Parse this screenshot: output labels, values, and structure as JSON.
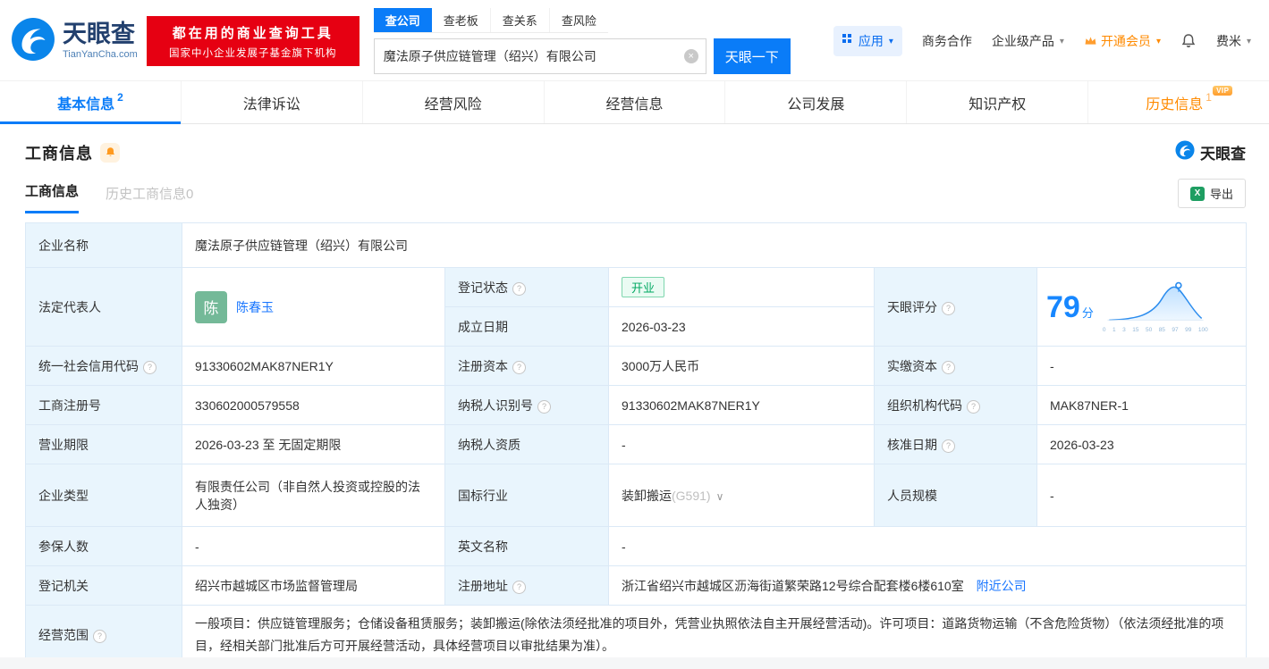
{
  "brand": {
    "name": "天眼查",
    "domain": "TianYanCha.com",
    "slogan1": "都在用的商业查询工具",
    "slogan2": "国家中小企业发展子基金旗下机构"
  },
  "search": {
    "tabs": [
      "查公司",
      "查老板",
      "查关系",
      "查风险"
    ],
    "value": "魔法原子供应链管理（绍兴）有限公司",
    "button": "天眼一下"
  },
  "topnav": {
    "app": "应用",
    "cooperation": "商务合作",
    "enterprise": "企业级产品",
    "vip": "开通会员",
    "user": "费米"
  },
  "icons": {
    "help": "?",
    "clear": "×",
    "caret": "▾",
    "chevron": "∨",
    "excel": "X"
  },
  "tabs": {
    "basic": "基本信息",
    "basic_count": "2",
    "legal": "法律诉讼",
    "risk": "经营风险",
    "operation": "经营信息",
    "development": "公司发展",
    "ip": "知识产权",
    "history": "历史信息",
    "history_count": "1",
    "vip_tag": "VIP"
  },
  "section": {
    "title": "工商信息",
    "subtab_current": "工商信息",
    "subtab_history": "历史工商信息0",
    "export": "导出",
    "brand": "天眼查"
  },
  "fields": {
    "company_name": {
      "label": "企业名称",
      "value": "魔法原子供应链管理（绍兴）有限公司"
    },
    "legal_rep": {
      "label": "法定代表人",
      "avatar": "陈",
      "name": "陈春玉"
    },
    "reg_status": {
      "label": "登记状态",
      "value": "开业"
    },
    "establish_date": {
      "label": "成立日期",
      "value": "2026-03-23"
    },
    "score": {
      "label": "天眼评分",
      "value": "79",
      "unit": "分",
      "axis": [
        "0",
        "1",
        "3",
        "15",
        "50",
        "85",
        "97",
        "99",
        "100"
      ]
    },
    "credit_code": {
      "label": "统一社会信用代码",
      "value": "91330602MAK87NER1Y"
    },
    "reg_capital": {
      "label": "注册资本",
      "value": "3000万人民币"
    },
    "paid_capital": {
      "label": "实缴资本",
      "value": "-"
    },
    "reg_number": {
      "label": "工商注册号",
      "value": "330602000579558"
    },
    "taxpayer_id": {
      "label": "纳税人识别号",
      "value": "91330602MAK87NER1Y"
    },
    "org_code": {
      "label": "组织机构代码",
      "value": "MAK87NER-1"
    },
    "business_term": {
      "label": "营业期限",
      "value": "2026-03-23 至 无固定期限"
    },
    "taxpayer_qual": {
      "label": "纳税人资质",
      "value": "-"
    },
    "approval_date": {
      "label": "核准日期",
      "value": "2026-03-23"
    },
    "company_type": {
      "label": "企业类型",
      "value": "有限责任公司（非自然人投资或控股的法人独资）"
    },
    "industry": {
      "label": "国标行业",
      "value": "装卸搬运",
      "code": "(G591)"
    },
    "staff_size": {
      "label": "人员规模",
      "value": "-"
    },
    "insured_count": {
      "label": "参保人数",
      "value": "-"
    },
    "english_name": {
      "label": "英文名称",
      "value": "-"
    },
    "reg_authority": {
      "label": "登记机关",
      "value": "绍兴市越城区市场监督管理局"
    },
    "reg_address": {
      "label": "注册地址",
      "value": "浙江省绍兴市越城区沥海街道繁荣路12号综合配套楼6楼610室",
      "link": "附近公司"
    },
    "business_scope": {
      "label": "经营范围",
      "value": "一般项目：供应链管理服务；仓储设备租赁服务；装卸搬运(除依法须经批准的项目外，凭营业执照依法自主开展经营活动)。许可项目：道路货物运输（不含危险货物）（依法须经批准的项目，经相关部门批准后方可开展经营活动，具体经营项目以审批结果为准）。"
    }
  },
  "colors": {
    "primary": "#0a7cf8",
    "orange": "#ff8a00",
    "green": "#00a862",
    "red": "#e60012"
  }
}
